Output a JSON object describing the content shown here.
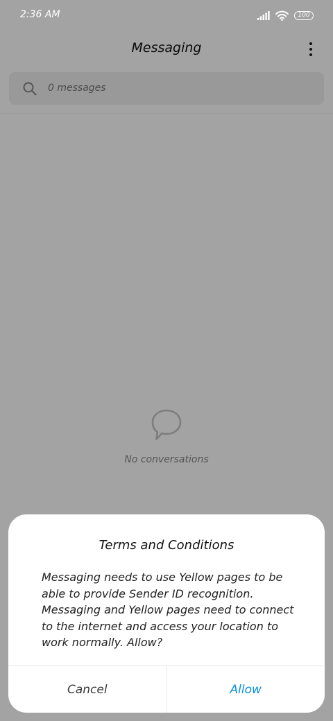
{
  "status_bar": {
    "time": "2:36 AM",
    "battery_level": "100",
    "icons": [
      "signal-icon",
      "wifi-icon",
      "battery-icon"
    ]
  },
  "app_bar": {
    "title": "Messaging",
    "menu_icon": "more-vertical-icon"
  },
  "search": {
    "icon": "search-icon",
    "placeholder": "0 messages"
  },
  "empty_state": {
    "icon": "chat-bubble-icon",
    "text": "No conversations"
  },
  "dialog": {
    "title": "Terms and Conditions",
    "message": "Messaging needs to use Yellow pages to be able to provide Sender ID recognition. Messaging and Yellow pages need to connect to the internet and access your location to work normally. Allow?",
    "cancel_label": "Cancel",
    "allow_label": "Allow"
  },
  "colors": {
    "scrim_background": "#a3a3a3",
    "accent": "#0b8ee8",
    "dialog_background": "#ffffff"
  }
}
